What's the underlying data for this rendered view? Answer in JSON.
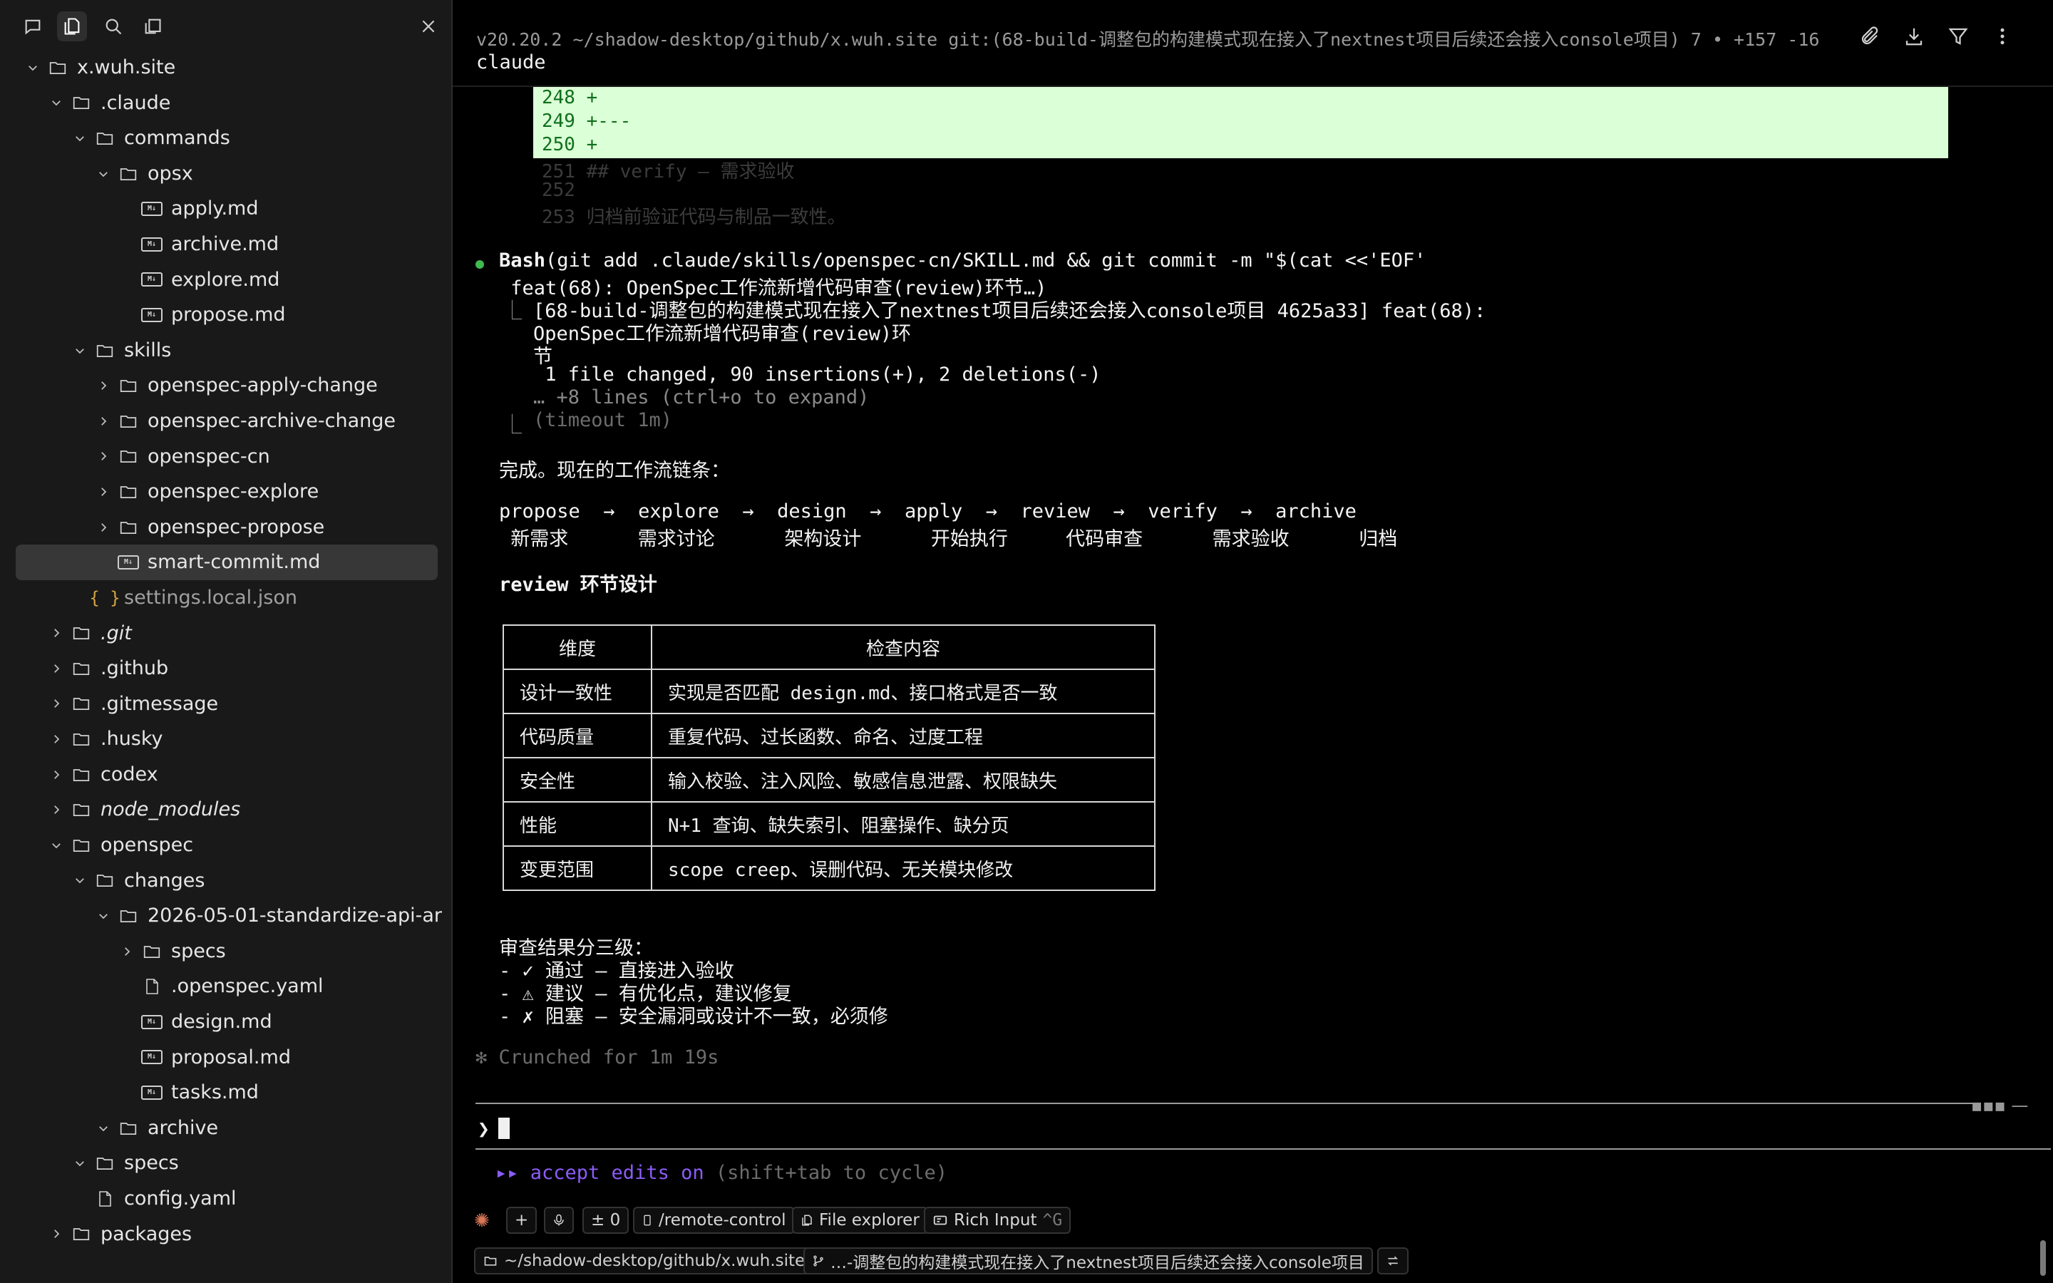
{
  "sidebar": {
    "toolbar_icons": [
      "chat-icon",
      "files-icon",
      "search-icon",
      "panel-icon",
      "close-icon"
    ],
    "tree": [
      {
        "label": "x.wuh.site",
        "type": "folder",
        "depth": 0,
        "expanded": true
      },
      {
        "label": ".claude",
        "type": "folder",
        "depth": 1,
        "expanded": true
      },
      {
        "label": "commands",
        "type": "folder",
        "depth": 2,
        "expanded": true
      },
      {
        "label": "opsx",
        "type": "folder",
        "depth": 3,
        "expanded": true
      },
      {
        "label": "apply.md",
        "type": "md",
        "depth": 4
      },
      {
        "label": "archive.md",
        "type": "md",
        "depth": 4
      },
      {
        "label": "explore.md",
        "type": "md",
        "depth": 4
      },
      {
        "label": "propose.md",
        "type": "md",
        "depth": 4
      },
      {
        "label": "skills",
        "type": "folder",
        "depth": 2,
        "expanded": true
      },
      {
        "label": "openspec-apply-change",
        "type": "folder",
        "depth": 3,
        "expanded": false
      },
      {
        "label": "openspec-archive-change",
        "type": "folder",
        "depth": 3,
        "expanded": false
      },
      {
        "label": "openspec-cn",
        "type": "folder",
        "depth": 3,
        "expanded": false
      },
      {
        "label": "openspec-explore",
        "type": "folder",
        "depth": 3,
        "expanded": false
      },
      {
        "label": "openspec-propose",
        "type": "folder",
        "depth": 3,
        "expanded": false
      },
      {
        "label": "smart-commit.md",
        "type": "md",
        "depth": 3,
        "selected": true
      },
      {
        "label": "settings.local.json",
        "type": "json",
        "depth": 2,
        "dim": true
      },
      {
        "label": ".git",
        "type": "folder",
        "depth": 1,
        "expanded": false,
        "italic": true
      },
      {
        "label": ".github",
        "type": "folder",
        "depth": 1,
        "expanded": false
      },
      {
        "label": ".gitmessage",
        "type": "folder",
        "depth": 1,
        "expanded": false
      },
      {
        "label": ".husky",
        "type": "folder",
        "depth": 1,
        "expanded": false
      },
      {
        "label": "codex",
        "type": "folder",
        "depth": 1,
        "expanded": false
      },
      {
        "label": "node_modules",
        "type": "folder",
        "depth": 1,
        "expanded": false,
        "italic": true
      },
      {
        "label": "openspec",
        "type": "folder",
        "depth": 1,
        "expanded": true
      },
      {
        "label": "changes",
        "type": "folder",
        "depth": 2,
        "expanded": true
      },
      {
        "label": "2026-05-01-standardize-api-ar",
        "type": "folder",
        "depth": 3,
        "expanded": true
      },
      {
        "label": "specs",
        "type": "folder",
        "depth": 4,
        "expanded": false
      },
      {
        "label": ".openspec.yaml",
        "type": "file",
        "depth": 4
      },
      {
        "label": "design.md",
        "type": "md",
        "depth": 4
      },
      {
        "label": "proposal.md",
        "type": "md",
        "depth": 4
      },
      {
        "label": "tasks.md",
        "type": "md",
        "depth": 4
      },
      {
        "label": "archive",
        "type": "folder",
        "depth": 3,
        "expanded": true
      },
      {
        "label": "specs",
        "type": "folder",
        "depth": 2,
        "expanded": true
      },
      {
        "label": "config.yaml",
        "type": "file",
        "depth": 2
      },
      {
        "label": "packages",
        "type": "folder",
        "depth": 1,
        "expanded": false
      }
    ]
  },
  "header": {
    "status_line": "v20.20.2 ~/shadow-desktop/github/x.wuh.site git:(68-build-调整包的构建模式现在接入了nextnest项目后续还会接入console项目) 7 • +157 -16",
    "title": "claude",
    "icons": [
      "attachment-icon",
      "download-icon",
      "filter-icon",
      "more-icon"
    ]
  },
  "diff": {
    "added": [
      "248 +",
      "249 +---",
      "250 +"
    ],
    "context": [
      "251  ## verify — 需求验收",
      "252",
      "253  归档前验证代码与制品一致性。"
    ]
  },
  "terminal": {
    "bash_tool": "Bash",
    "bash_cmd": "(git add .claude/skills/openspec-cn/SKILL.md && git commit -m \"$(cat <<'EOF'",
    "bash_cmd2": " feat(68): OpenSpec工作流新增代码审查(review)环节…)",
    "out1": "[68-build-调整包的构建模式现在接入了nextnest项目后续还会接入console项目 4625a33] feat(68):",
    "out2": "OpenSpec工作流新增代码审查(review)环",
    "out3": "节",
    "out4": " 1 file changed, 90 insertions(+), 2 deletions(-)",
    "out5": "… +8 lines (ctrl+o to expand)",
    "timeout": "(timeout 1m)",
    "done": "完成。现在的工作流链条：",
    "chain": "propose  →  explore  →  design  →  apply  →  review  →  verify  →  archive",
    "chain_cn": " 新需求      需求讨论      架构设计      开始执行     代码审查      需求验收      归档",
    "review_title": "review 环节设计",
    "table": {
      "headers": [
        "维度",
        "检查内容"
      ],
      "rows": [
        [
          "设计一致性",
          "实现是否匹配 design.md、接口格式是否一致"
        ],
        [
          "代码质量",
          "重复代码、过长函数、命名、过度工程"
        ],
        [
          "安全性",
          "输入校验、注入风险、敏感信息泄露、权限缺失"
        ],
        [
          "性能",
          "N+1 查询、缺失索引、阻塞操作、缺分页"
        ],
        [
          "变更范围",
          "scope creep、误删代码、无关模块修改"
        ]
      ]
    },
    "levels_title": "审查结果分三级：",
    "level1": "- ✓ 通过 — 直接进入验收",
    "level2": "- ⚠ 建议 — 有优化点，建议修复",
    "level3": "- ✗ 阻塞 — 安全漏洞或设计不一致，必须修",
    "crunched": "✻ Crunched for 1m 19s"
  },
  "prompt": {
    "caret": "❯",
    "accept_prefix": "▸▸ accept edits on",
    "accept_hint": " (shift+tab to cycle)"
  },
  "bottom_bar": {
    "add": "+",
    "diff_count": "± 0",
    "remote_control": "/remote-control",
    "file_explorer": "File explorer",
    "rich_input": "Rich Input",
    "rich_input_kb": "^G",
    "path": "~/shadow-desktop/github/x.wuh.site",
    "branch": "…-调整包的构建模式现在接入了nextnest项目后续还会接入console项目"
  },
  "colors": {
    "accent_purple": "#8b5cf6",
    "diff_bg": "#dbffd6",
    "success_dot": "#3fb950",
    "claude_orange": "#d97757"
  }
}
